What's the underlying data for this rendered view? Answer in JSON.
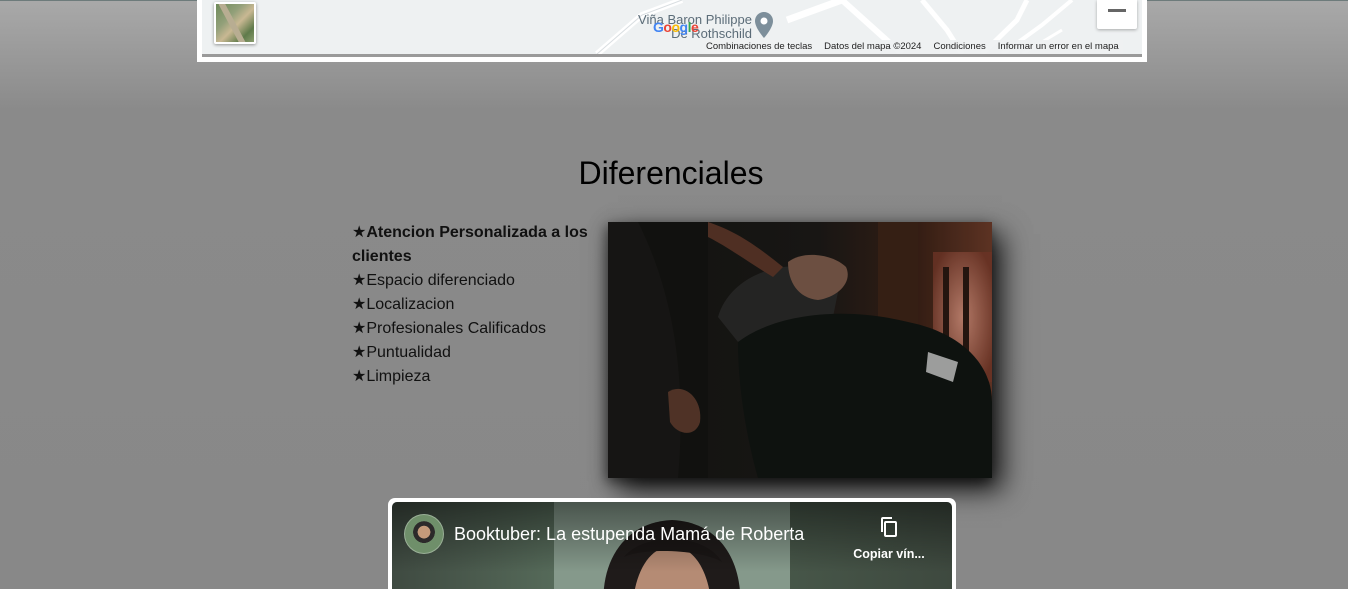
{
  "map": {
    "place_label": "Viña Baron Philippe De Rothschild",
    "place_line1": "Viña Baron Philippe",
    "place_line2": "De Rothschild",
    "google_logo": "Google",
    "footer": {
      "shortcuts": "Combinaciones de teclas",
      "map_data": "Datos del mapa ©2024",
      "terms": "Condiciones",
      "report": "Informar un error en el mapa"
    },
    "thumbnail_icon": "satellite-layer-icon",
    "zoom_out_icon": "minus-icon"
  },
  "section": {
    "title": "Diferenciales",
    "features": [
      {
        "star": "★",
        "text": "Atencion Personalizada a los clientes",
        "bold": true
      },
      {
        "star": "★",
        "text": "Espacio diferenciado"
      },
      {
        "star": "★",
        "text": "Localizacion"
      },
      {
        "star": "★",
        "text": "Profesionales Calificados"
      },
      {
        "star": "★",
        "text": "Puntualidad"
      },
      {
        "star": "★",
        "text": "Limpieza"
      }
    ]
  },
  "video": {
    "title": "Booktuber: La estupenda Mamá de Roberta",
    "copy_link_label": "Copiar vín...",
    "copy_icon": "copy-icon"
  },
  "colors": {
    "background": "#888888",
    "map_background": "#eef1f2",
    "map_text": "#5b6c78"
  }
}
